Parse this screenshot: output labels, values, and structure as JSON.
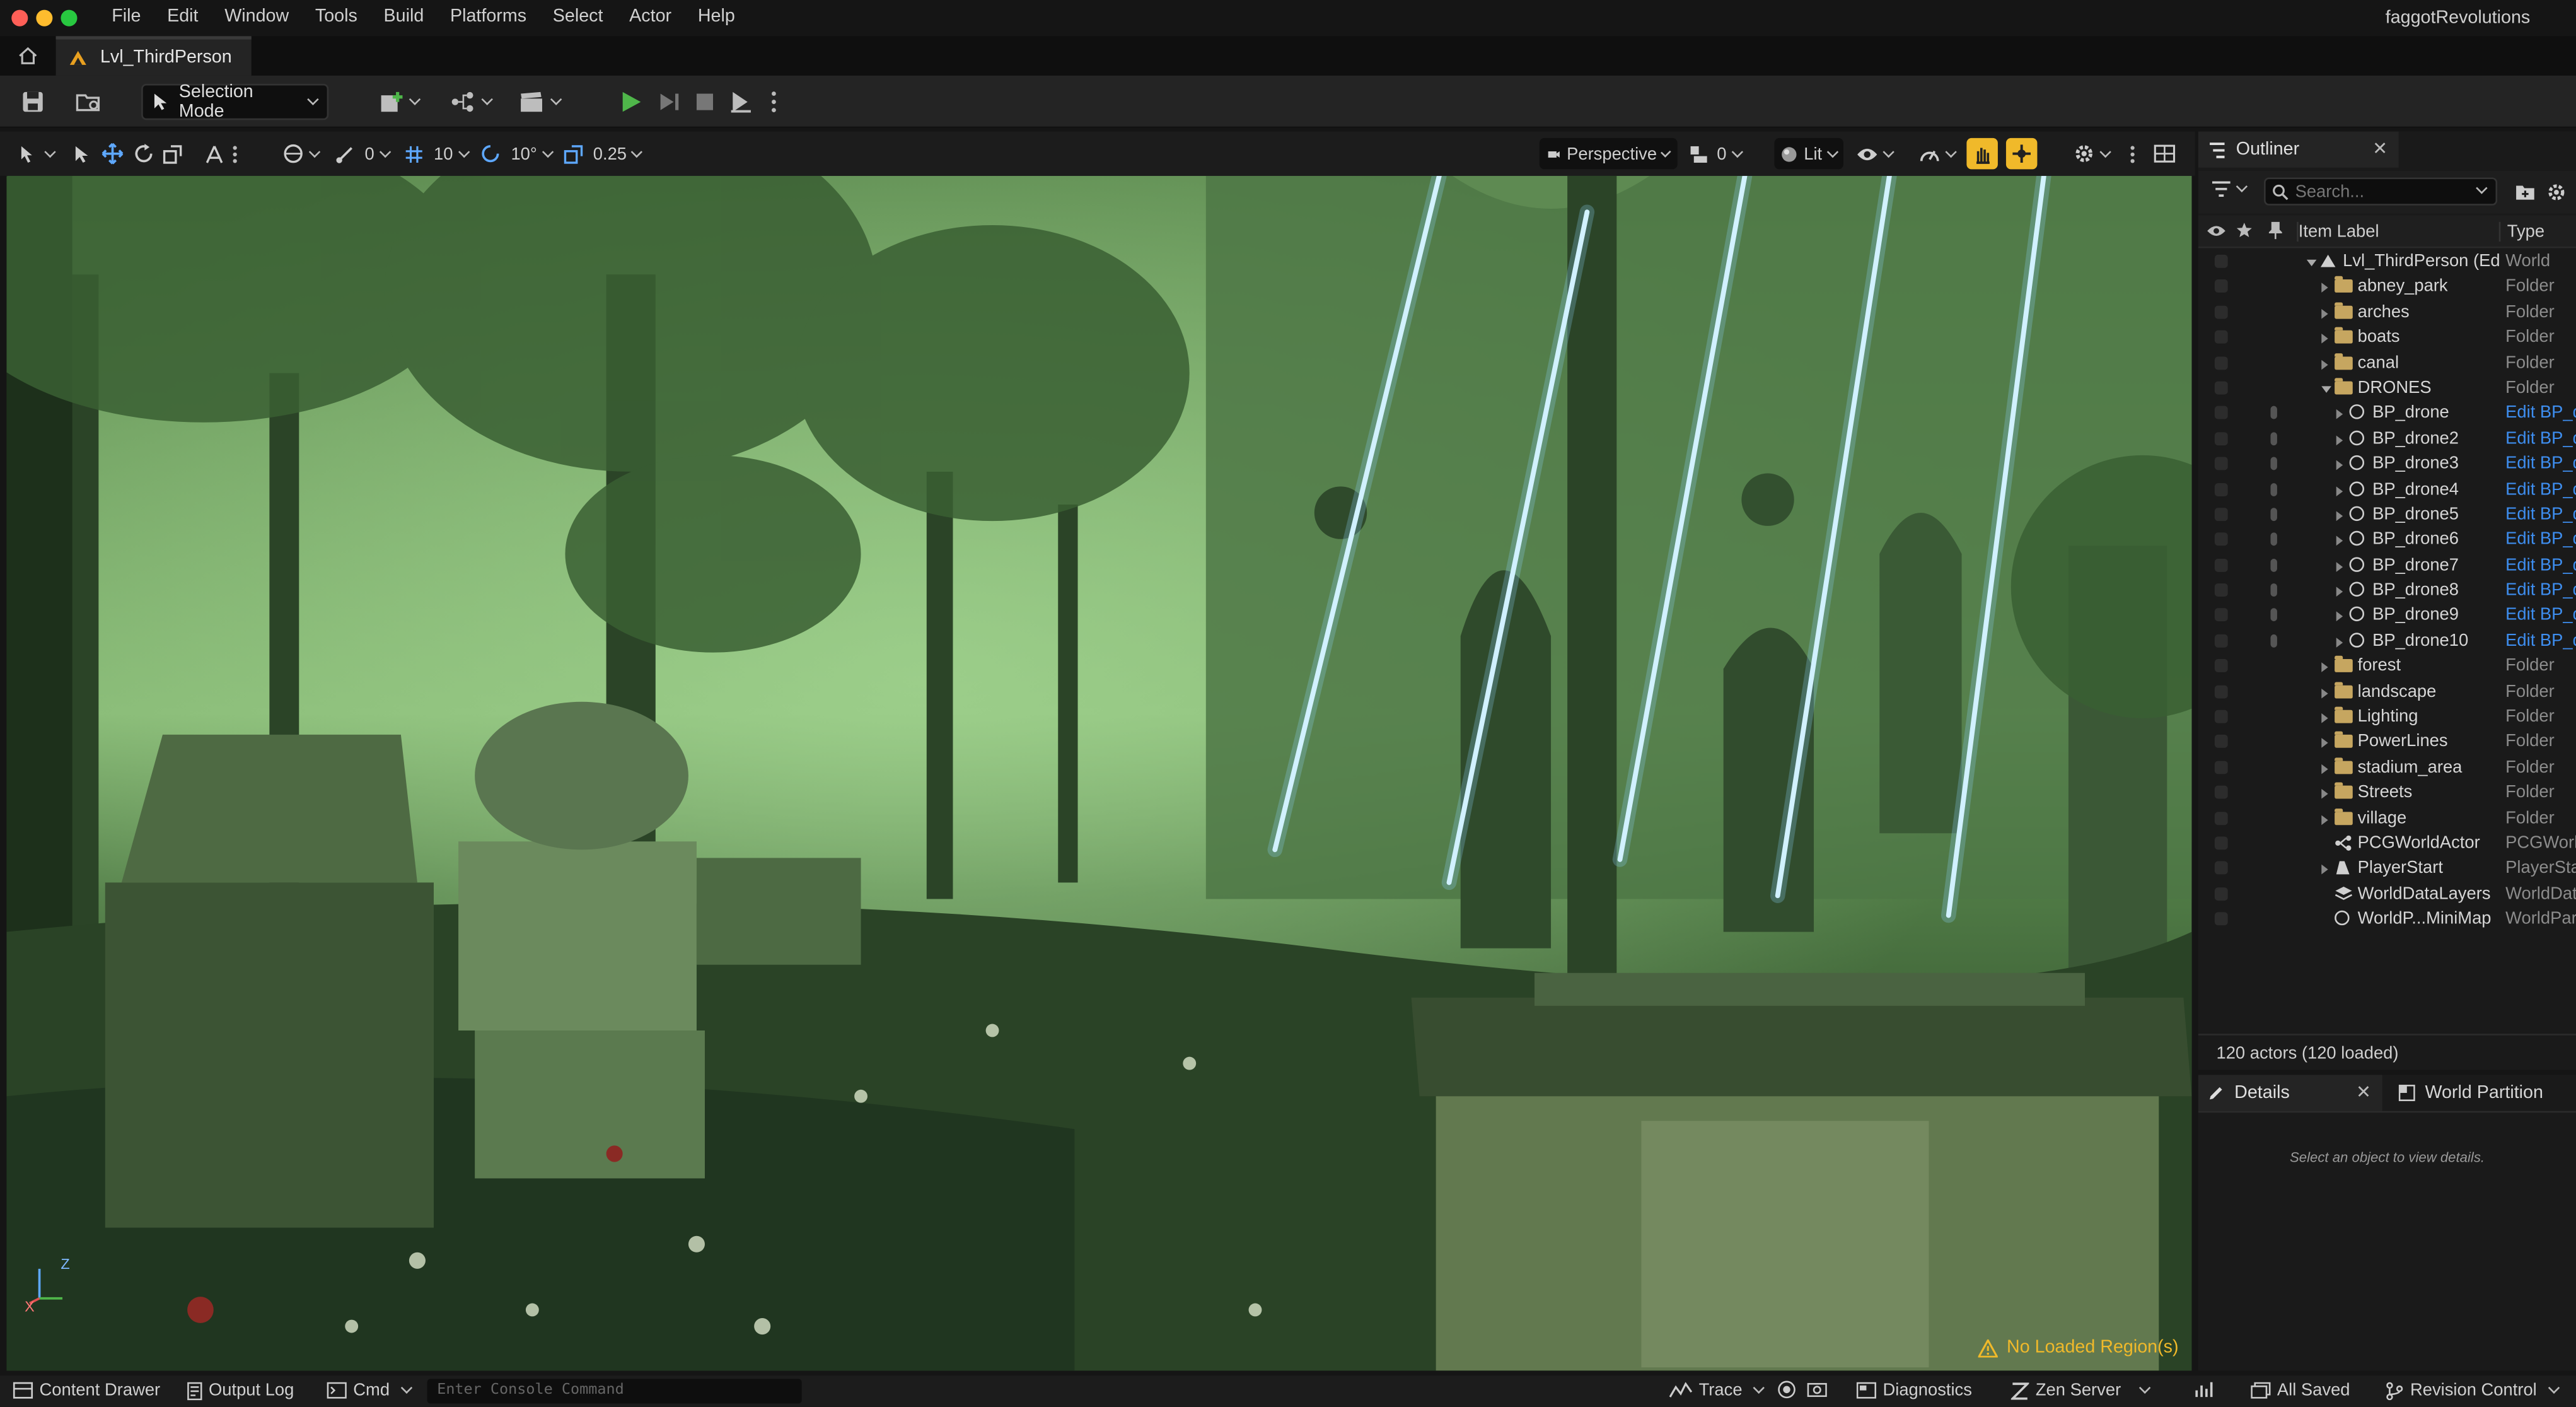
{
  "app": {
    "menus": [
      "File",
      "Edit",
      "Window",
      "Tools",
      "Build",
      "Platforms",
      "Select",
      "Actor",
      "Help"
    ],
    "user_name": "faggotRevolutions",
    "level_tab": "Lvl_ThirdPerson"
  },
  "toolbar": {
    "selection_mode": "Selection Mode"
  },
  "viewport_toolbar": {
    "snap_rotation_value": "0",
    "grid_snap_value": "10",
    "rotation_snap_value": "10°",
    "scale_snap_value": "0.25",
    "perspective_label": "Perspective",
    "camera_speed_value": "0",
    "view_mode_label": "Lit"
  },
  "viewport": {
    "warning": "No Loaded Region(s)",
    "axis_z": "Z",
    "axis_x": "X"
  },
  "outliner": {
    "tab_label": "Outliner",
    "search_placeholder": "Search...",
    "columns": {
      "label": "Item Label",
      "type": "Type"
    },
    "items": [
      {
        "label": "Lvl_ThirdPerson (Ed",
        "type": "World",
        "icon": "level"
      },
      {
        "label": "abney_park",
        "type": "Folder",
        "icon": "folder"
      },
      {
        "label": "arches",
        "type": "Folder",
        "icon": "folder"
      },
      {
        "label": "boats",
        "type": "Folder",
        "icon": "folder"
      },
      {
        "label": "canal",
        "type": "Folder",
        "icon": "folder"
      },
      {
        "label": "DRONES",
        "type": "Folder",
        "icon": "folder-open"
      },
      {
        "label": "BP_drone",
        "type": "Edit BP_d",
        "icon": "actor"
      },
      {
        "label": "BP_drone2",
        "type": "Edit BP_d",
        "icon": "actor"
      },
      {
        "label": "BP_drone3",
        "type": "Edit BP_d",
        "icon": "actor"
      },
      {
        "label": "BP_drone4",
        "type": "Edit BP_d",
        "icon": "actor"
      },
      {
        "label": "BP_drone5",
        "type": "Edit BP_d",
        "icon": "actor"
      },
      {
        "label": "BP_drone6",
        "type": "Edit BP_d",
        "icon": "actor"
      },
      {
        "label": "BP_drone7",
        "type": "Edit BP_d",
        "icon": "actor"
      },
      {
        "label": "BP_drone8",
        "type": "Edit BP_d",
        "icon": "actor"
      },
      {
        "label": "BP_drone9",
        "type": "Edit BP_d",
        "icon": "actor"
      },
      {
        "label": "BP_drone10",
        "type": "Edit BP_d",
        "icon": "actor"
      },
      {
        "label": "forest",
        "type": "Folder",
        "icon": "folder"
      },
      {
        "label": "landscape",
        "type": "Folder",
        "icon": "folder"
      },
      {
        "label": "Lighting",
        "type": "Folder",
        "icon": "folder"
      },
      {
        "label": "PowerLines",
        "type": "Folder",
        "icon": "folder"
      },
      {
        "label": "stadium_area",
        "type": "Folder",
        "icon": "folder"
      },
      {
        "label": "Streets",
        "type": "Folder",
        "icon": "folder"
      },
      {
        "label": "village",
        "type": "Folder",
        "icon": "folder"
      },
      {
        "label": "PCGWorldActor",
        "type": "PCGWorl",
        "icon": "pcg"
      },
      {
        "label": "PlayerStart",
        "type": "PlayerSta",
        "icon": "player"
      },
      {
        "label": "WorldDataLayers",
        "type": "WorldDat",
        "icon": "layers"
      },
      {
        "label": "WorldP...MiniMap",
        "type": "WorldPar",
        "icon": "actor"
      }
    ],
    "actor_count": "120 actors (120 loaded)"
  },
  "details": {
    "tab_label": "Details",
    "world_partition_tab": "World Partition",
    "empty_message": "Select an object to view details."
  },
  "statusbar": {
    "content_drawer": "Content Drawer",
    "output_log": "Output Log",
    "cmd": "Cmd",
    "console_placeholder": "Enter Console Command",
    "trace": "Trace",
    "diagnostics": "Diagnostics",
    "zen_server": "Zen Server",
    "all_saved": "All Saved",
    "revision_control": "Revision Control"
  },
  "colors": {
    "accent_yellow": "#f0b92a",
    "play_green": "#4fb64a",
    "link_blue": "#3e8ef0",
    "folder": "#c6a660"
  }
}
